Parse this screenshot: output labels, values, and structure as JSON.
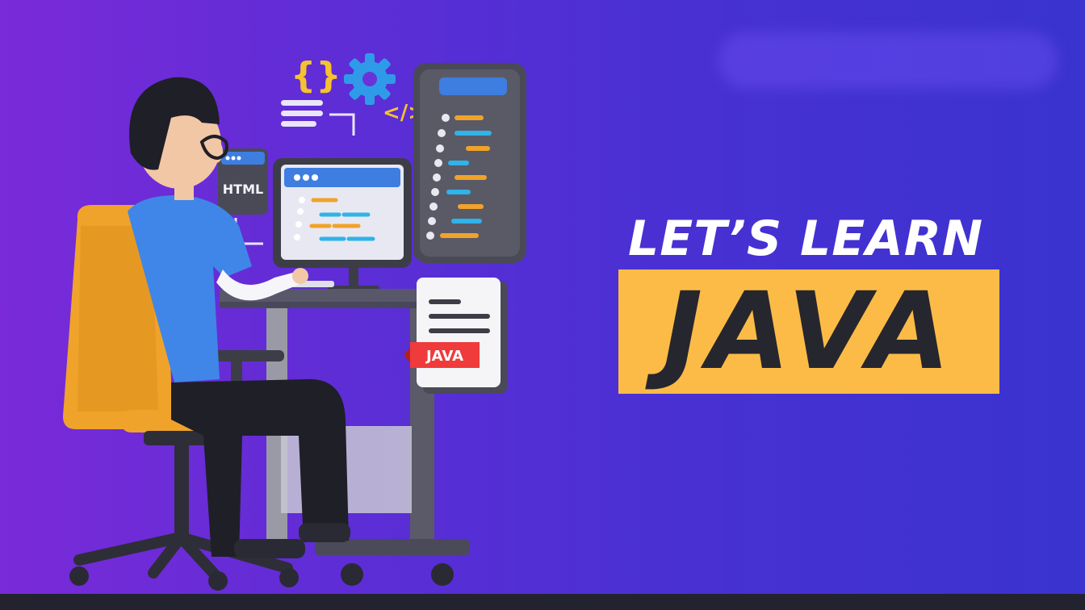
{
  "headline": {
    "line1": "LET’S LEARN",
    "line2": "JAVA"
  },
  "illustration": {
    "html_card_label": "HTML",
    "document_ribbon_label": "JAVA",
    "icons": [
      "curly-braces-icon",
      "gear-icon",
      "code-tag-icon",
      "text-lines-icon"
    ]
  },
  "colors": {
    "background_left": "#7a2ad8",
    "background_right": "#3a33cf",
    "banner": "#fbbb46",
    "banner_text": "#26262e",
    "headline_text": "#ffffff",
    "chair": "#f0a32a",
    "shirt": "#3f86e8",
    "ribbon": "#ef3b3b",
    "floor": "#23232f"
  }
}
